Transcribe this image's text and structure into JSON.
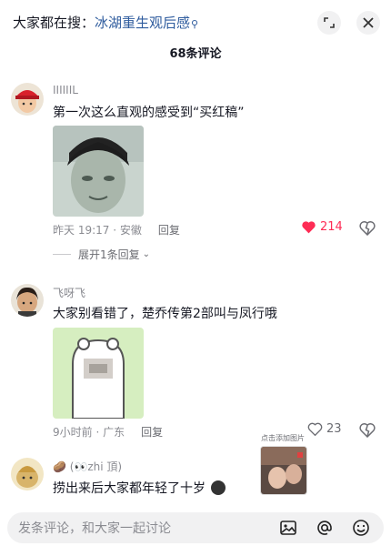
{
  "header": {
    "search_prefix": "大家都在搜：",
    "search_keyword": "冰湖重生观后感",
    "comment_count": "68条评论"
  },
  "icons": {
    "expand": "expand-icon",
    "close": "close-icon",
    "search": "search-icon",
    "heart": "heart-icon",
    "dislike": "broken-heart-icon",
    "image": "image-icon",
    "mention": "at-icon",
    "emoji": "emoji-icon"
  },
  "colors": {
    "liked": "#fe2c55",
    "keyword": "#2f5c9e"
  },
  "comments": [
    {
      "username": "IIIIIIL",
      "text": "第一次这么直观的感受到“买红稿”",
      "time_location": "昨天 19:17 · 安徽",
      "reply_label": "回复",
      "likes": "214",
      "liked": true,
      "expand_replies": "展开1条回复"
    },
    {
      "username": "飞呀飞",
      "text": "大家别看错了，楚乔传第2部叫与凤行哦",
      "time_location": "9小时前 · 广东",
      "reply_label": "回复",
      "likes": "23",
      "liked": false
    },
    {
      "username_prefix": "🥔 (👀zhi 頂)",
      "text": "捞出来后大家都年轻了十岁"
    }
  ],
  "floating": {
    "caption": "点击添加图片"
  },
  "input": {
    "placeholder": "发条评论，和大家一起讨论"
  }
}
